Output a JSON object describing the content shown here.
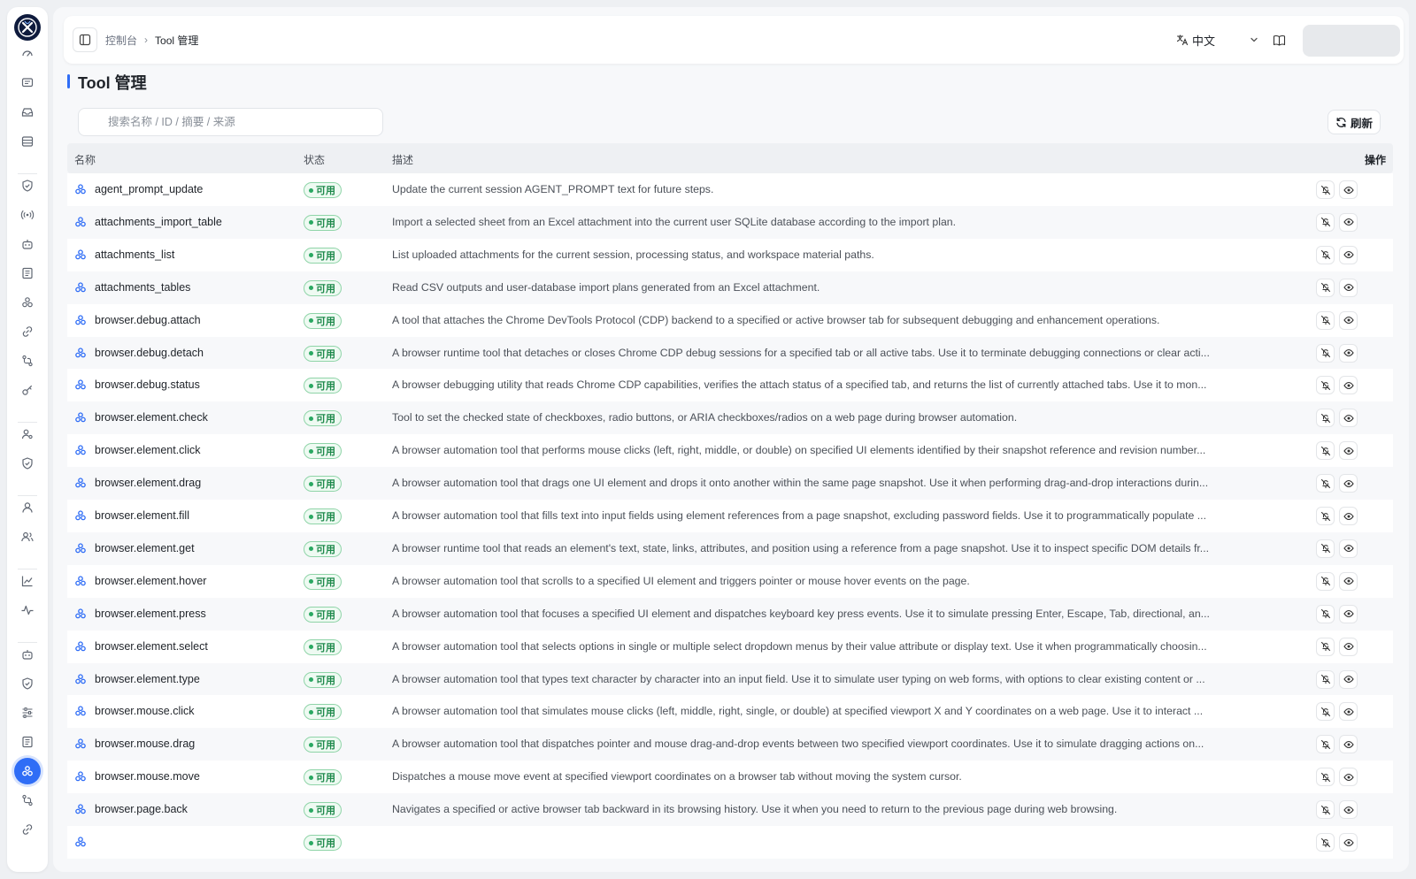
{
  "breadcrumb": {
    "home": "控制台",
    "current": "Tool 管理"
  },
  "language": {
    "label": "中文"
  },
  "page": {
    "title": "Tool 管理"
  },
  "search": {
    "placeholder": "搜索名称 / ID / 摘要 / 来源",
    "value": ""
  },
  "toolbar": {
    "refresh_label": "刷新"
  },
  "table": {
    "columns": {
      "name": "名称",
      "status": "状态",
      "description": "描述",
      "actions": "操作"
    },
    "rows": [
      {
        "name": "agent_prompt_update",
        "status": "可用",
        "description": "Update the current session AGENT_PROMPT text for future steps."
      },
      {
        "name": "attachments_import_table",
        "status": "可用",
        "description": "Import a selected sheet from an Excel attachment into the current user SQLite database according to the import plan."
      },
      {
        "name": "attachments_list",
        "status": "可用",
        "description": "List uploaded attachments for the current session, processing status, and workspace material paths."
      },
      {
        "name": "attachments_tables",
        "status": "可用",
        "description": "Read CSV outputs and user-database import plans generated from an Excel attachment."
      },
      {
        "name": "browser.debug.attach",
        "status": "可用",
        "description": "A tool that attaches the Chrome DevTools Protocol (CDP) backend to a specified or active browser tab for subsequent debugging and enhancement operations."
      },
      {
        "name": "browser.debug.detach",
        "status": "可用",
        "description": "A browser runtime tool that detaches or closes Chrome CDP debug sessions for a specified tab or all active tabs. Use it to terminate debugging connections or clear acti..."
      },
      {
        "name": "browser.debug.status",
        "status": "可用",
        "description": "A browser debugging utility that reads Chrome CDP capabilities, verifies the attach status of a specified tab, and returns the list of currently attached tabs. Use it to mon..."
      },
      {
        "name": "browser.element.check",
        "status": "可用",
        "description": "Tool to set the checked state of checkboxes, radio buttons, or ARIA checkboxes/radios on a web page during browser automation."
      },
      {
        "name": "browser.element.click",
        "status": "可用",
        "description": "A browser automation tool that performs mouse clicks (left, right, middle, or double) on specified UI elements identified by their snapshot reference and revision number..."
      },
      {
        "name": "browser.element.drag",
        "status": "可用",
        "description": "A browser automation tool that drags one UI element and drops it onto another within the same page snapshot. Use it when performing drag-and-drop interactions durin..."
      },
      {
        "name": "browser.element.fill",
        "status": "可用",
        "description": "A browser automation tool that fills text into input fields using element references from a page snapshot, excluding password fields. Use it to programmatically populate ..."
      },
      {
        "name": "browser.element.get",
        "status": "可用",
        "description": "A browser runtime tool that reads an element's text, state, links, attributes, and position using a reference from a page snapshot. Use it to inspect specific DOM details fr..."
      },
      {
        "name": "browser.element.hover",
        "status": "可用",
        "description": "A browser automation tool that scrolls to a specified UI element and triggers pointer or mouse hover events on the page."
      },
      {
        "name": "browser.element.press",
        "status": "可用",
        "description": "A browser automation tool that focuses a specified UI element and dispatches keyboard key press events. Use it to simulate pressing Enter, Escape, Tab, directional, an..."
      },
      {
        "name": "browser.element.select",
        "status": "可用",
        "description": "A browser automation tool that selects options in single or multiple select dropdown menus by their value attribute or display text. Use it when programmatically choosin..."
      },
      {
        "name": "browser.element.type",
        "status": "可用",
        "description": "A browser automation tool that types text character by character into an input field. Use it to simulate user typing on web forms, with options to clear existing content or ..."
      },
      {
        "name": "browser.mouse.click",
        "status": "可用",
        "description": "A browser automation tool that simulates mouse clicks (left, middle, right, single, or double) at specified viewport X and Y coordinates on a web page. Use it to interact ..."
      },
      {
        "name": "browser.mouse.drag",
        "status": "可用",
        "description": "A browser automation tool that dispatches pointer and mouse drag-and-drop events between two specified viewport coordinates. Use it to simulate dragging actions on..."
      },
      {
        "name": "browser.mouse.move",
        "status": "可用",
        "description": "Dispatches a mouse move event at specified viewport coordinates on a browser tab without moving the system cursor."
      },
      {
        "name": "browser.page.back",
        "status": "可用",
        "description": "Navigates a specified or active browser tab backward in its browsing history. Use it when you need to return to the previous page during web browsing."
      },
      {
        "name": "",
        "status": "可用",
        "description": ""
      }
    ]
  },
  "icons": {
    "logo": "x-logo",
    "sidebar": [
      "dashboard-icon",
      "chat-icon",
      "inbox-icon",
      "database-icon",
      "shield-check-icon",
      "broadcast-icon",
      "robot-icon",
      "document-list-icon",
      "cluster-icon",
      "link-icon",
      "route-icon",
      "key-icon",
      "user-settings-icon",
      "shield-icon",
      "user-icon",
      "users-icon",
      "line-chart-icon",
      "activity-icon",
      "bot-icon",
      "shield-check-icon",
      "sliders-icon",
      "notebook-icon",
      "tools-icon",
      "route-icon",
      "link-icon"
    ],
    "row_actions": [
      "disable-icon",
      "view-icon"
    ]
  },
  "colors": {
    "accent": "#2f6df6",
    "status_available": "#1f8a4c"
  }
}
